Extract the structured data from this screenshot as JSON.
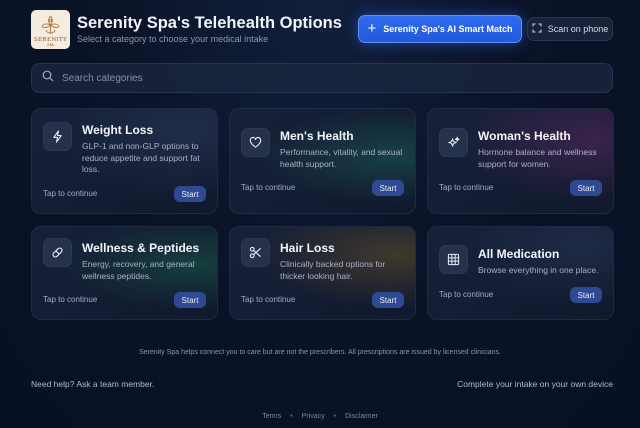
{
  "header": {
    "logo_text": "SERENITY",
    "logo_subtext": "SPA",
    "title": "Serenity Spa's Telehealth Options",
    "subtitle": "Select a category to choose your medical intake",
    "ai_button_label": "Serenity Spa's AI Smart Match",
    "scan_button_label": "Scan on phone"
  },
  "search": {
    "placeholder": "Search categories"
  },
  "cards": [
    {
      "title": "Weight Loss",
      "description": "GLP-1 and non-GLP options to reduce appetite and support fat loss.",
      "tap": "Tap to continue",
      "button": "Start",
      "icon": "lightning-icon"
    },
    {
      "title": "Men's Health",
      "description": "Performance, vitality, and sexual health support.",
      "tap": "Tap to continue",
      "button": "Start",
      "icon": "heart-icon"
    },
    {
      "title": "Woman's Health",
      "description": "Hormone balance and wellness support for women.",
      "tap": "Tap to continue",
      "button": "Start",
      "icon": "sparkle-icon"
    },
    {
      "title": "Wellness & Peptides",
      "description": "Energy, recovery, and general wellness peptides.",
      "tap": "Tap to continue",
      "button": "Start",
      "icon": "pill-icon"
    },
    {
      "title": "Hair Loss",
      "description": "Clinically backed options for thicker looking hair.",
      "tap": "Tap to continue",
      "button": "Start",
      "icon": "scissors-icon"
    },
    {
      "title": "All Medication",
      "description": "Browse everything in one place.",
      "tap": "Tap to continue",
      "button": "Start",
      "icon": "grid-icon"
    }
  ],
  "disclaimer": "Serenity Spa helps connect you to care but are not the prescribers. All prescriptions are issued by licensed clinicians.",
  "help_text": "Need help? Ask a team member.",
  "device_text": "Complete your intake on your own device",
  "footer": {
    "terms": "Terms",
    "privacy": "Privacy",
    "disclaimer": "Disclaimer"
  },
  "colors": {
    "accent": "#2f6cf0",
    "start_button": "#2f4a92",
    "background": "#0b1328"
  }
}
